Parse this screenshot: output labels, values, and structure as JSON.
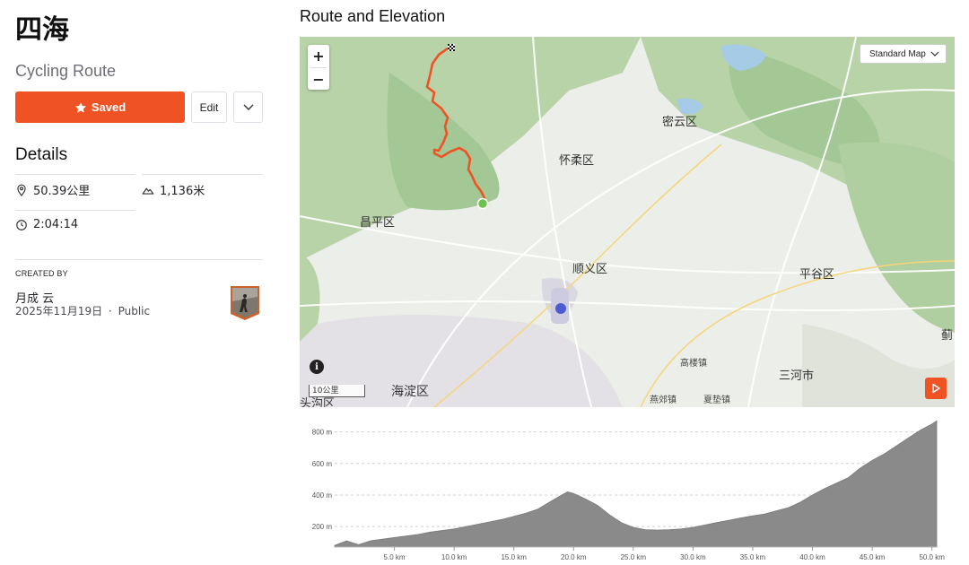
{
  "route": {
    "title": "四海",
    "type": "Cycling Route"
  },
  "actions": {
    "saved_label": "Saved",
    "edit_label": "Edit"
  },
  "details": {
    "heading": "Details",
    "distance": "50.39公里",
    "elevation_gain": "1,136米",
    "moving_time": "2:04:14"
  },
  "creator": {
    "label": "CREATED BY",
    "name": "月成 云",
    "date": "2025年11月19日",
    "separator": "·",
    "visibility": "Public"
  },
  "map": {
    "section_title": "Route and Elevation",
    "style_selected": "Standard Map",
    "zoom_in": "+",
    "zoom_out": "−",
    "info": "i",
    "scale_label": "10公里",
    "places": {
      "miyun": "密云区",
      "huairou": "怀柔区",
      "changping": "昌平区",
      "shunyi": "顺义区",
      "pinggu": "平谷区",
      "haidian": "海淀区",
      "sanhe": "三河市",
      "gaolou": "高楼镇",
      "yanjiao": "燕郊镇",
      "xiadian": "夏垫镇",
      "ji": "蓟",
      "tougou": "头沟区"
    },
    "colors": {
      "route": "#f05323",
      "start": "#6cc24a",
      "accent": "#f05323"
    }
  },
  "chart_data": {
    "type": "area",
    "x": [
      0,
      1,
      2,
      3,
      4,
      5,
      6,
      7,
      8,
      9,
      10,
      11,
      12,
      13,
      14,
      15,
      16,
      17,
      18,
      19,
      19.5,
      20,
      21,
      22,
      23,
      24,
      25,
      26,
      27,
      28,
      29,
      30,
      31,
      32,
      33,
      34,
      35,
      36,
      37,
      38,
      39,
      40,
      41,
      42,
      43,
      44,
      45,
      46,
      47,
      48,
      49,
      50,
      50.4
    ],
    "y": [
      80,
      110,
      85,
      110,
      120,
      130,
      140,
      150,
      165,
      175,
      185,
      200,
      215,
      230,
      245,
      265,
      285,
      310,
      355,
      400,
      420,
      410,
      375,
      335,
      275,
      225,
      195,
      180,
      178,
      180,
      185,
      195,
      210,
      225,
      240,
      255,
      268,
      280,
      300,
      320,
      355,
      400,
      440,
      475,
      510,
      570,
      620,
      660,
      710,
      760,
      810,
      850,
      870
    ],
    "xlabel": "",
    "ylabel": "",
    "xticks": [
      "5.0 km",
      "10.0 km",
      "15.0 km",
      "20.0 km",
      "25.0 km",
      "30.0 km",
      "35.0 km",
      "40.0 km",
      "45.0 km",
      "50.0 km"
    ],
    "xtick_values": [
      5,
      10,
      15,
      20,
      25,
      30,
      35,
      40,
      45,
      50
    ],
    "yticks": [
      "200 m",
      "400 m",
      "600 m",
      "800 m"
    ],
    "ytick_values": [
      200,
      400,
      600,
      800
    ],
    "xlim": [
      0,
      50.4
    ],
    "ylim": [
      70,
      900
    ],
    "grid": true,
    "fill_color": "#8a8a8a"
  }
}
